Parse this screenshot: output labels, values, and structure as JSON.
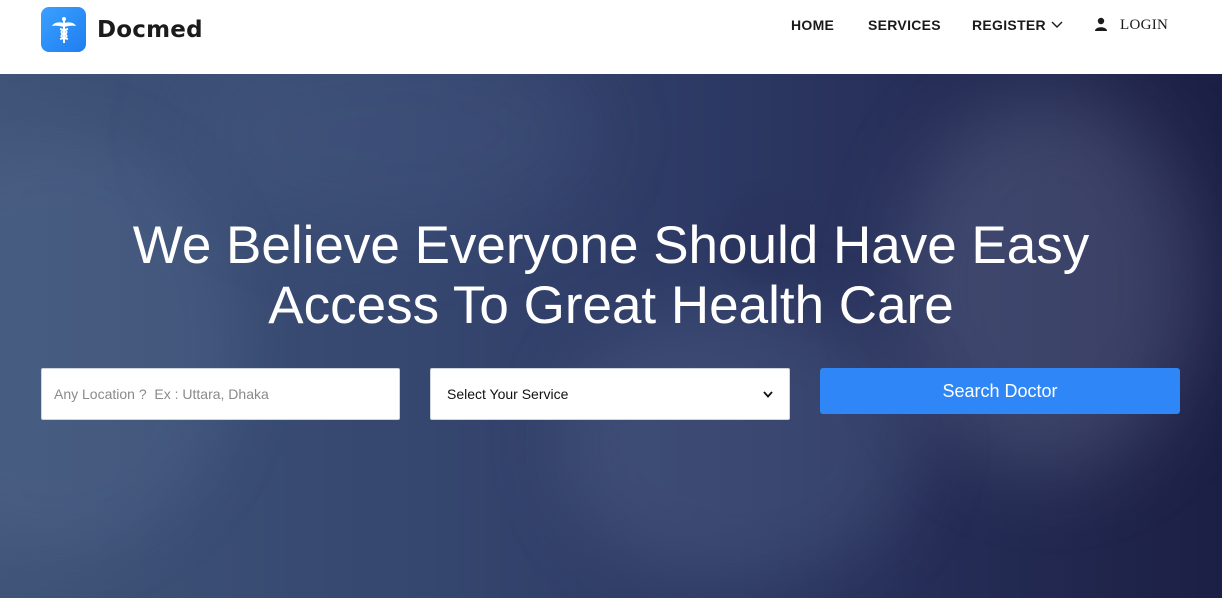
{
  "brand": {
    "name": "Docmed",
    "logo_icon": "caduceus-icon",
    "accent_color": "#2f86f6"
  },
  "nav": {
    "items": [
      {
        "label": "HOME"
      },
      {
        "label": "SERVICES"
      },
      {
        "label": "REGISTER",
        "icon": "chevron-down-icon"
      },
      {
        "label": "LOGIN",
        "icon": "user-icon"
      }
    ]
  },
  "hero": {
    "title_line1": "We Believe Everyone Should Have Easy",
    "title_line2": "Access To Great Health Care",
    "location_placeholder": "Any Location ?  Ex : Uttara, Dhaka",
    "location_value": "",
    "service_selected": "Select Your Service",
    "search_button_label": "Search Doctor"
  }
}
